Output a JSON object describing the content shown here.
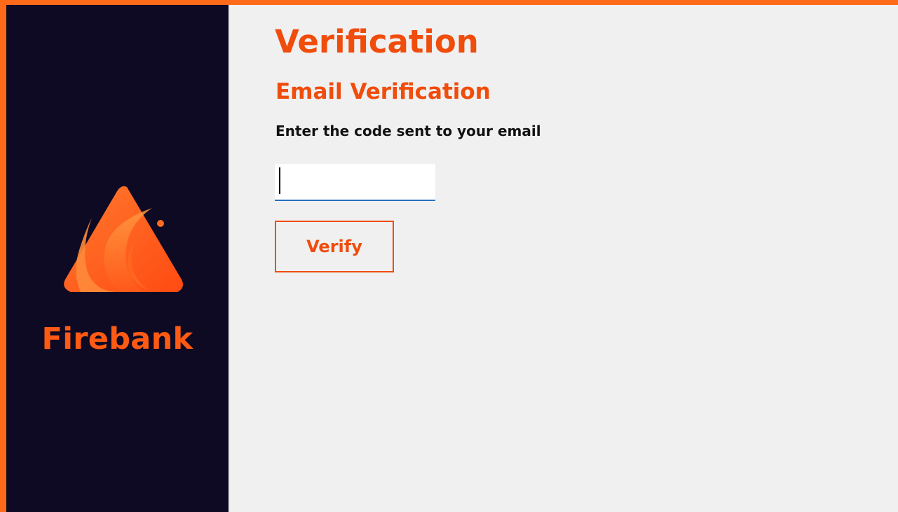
{
  "brand": {
    "name": "Firebank",
    "logo_icon": "flame-triangle-icon",
    "accent_color": "#ff5a14"
  },
  "colors": {
    "frame": "#ff6a1a",
    "sidebar_bg": "#0e0a24",
    "content_bg": "#f0f0f0",
    "heading": "#f04c0c",
    "input_underline": "#2a6fbf"
  },
  "main": {
    "title": "Verification",
    "section_title": "Email Verification",
    "instructions": "Enter the code sent to your email",
    "code_input": {
      "value": "",
      "placeholder": ""
    },
    "verify_label": "Verify"
  }
}
